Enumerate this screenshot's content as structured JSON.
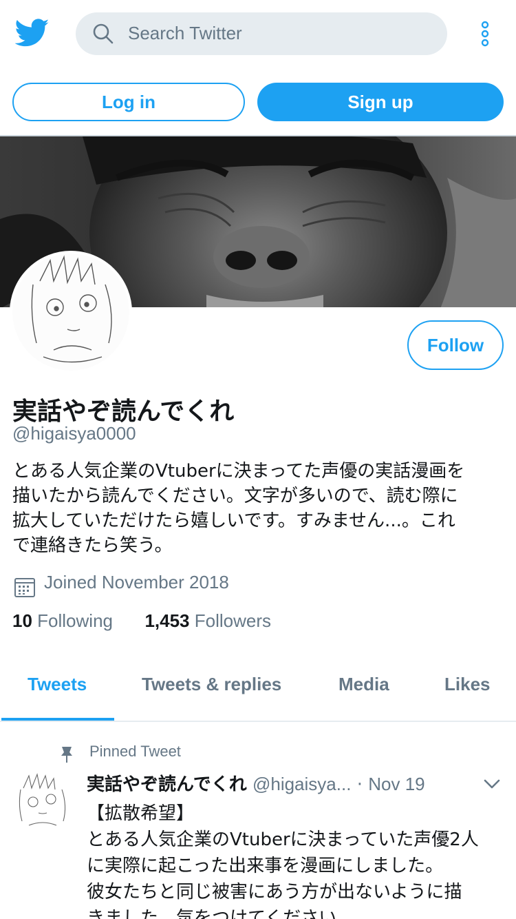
{
  "topbar": {
    "search_placeholder": "Search Twitter"
  },
  "auth": {
    "login_label": "Log in",
    "signup_label": "Sign up"
  },
  "profile": {
    "follow_label": "Follow",
    "display_name": "実話やぞ読んでくれ",
    "handle": "@higaisya0000",
    "bio_lines": [
      "とある人気企業のVtuberに決まってた声優の実話漫画を",
      "描いたから読んでください。文字が多いので、読む際に",
      "拡大していただけたら嬉しいです。すみません...。これ",
      "で連絡きたら笑う。"
    ],
    "joined": "Joined November 2018",
    "following_count": "10",
    "following_label": "Following",
    "followers_count": "1,453",
    "followers_label": "Followers"
  },
  "tabs": [
    {
      "label": "Tweets",
      "active": true
    },
    {
      "label": "Tweets & replies",
      "active": false
    },
    {
      "label": "Media",
      "active": false
    },
    {
      "label": "Likes",
      "active": false
    }
  ],
  "tweet": {
    "pinned_label": "Pinned Tweet",
    "name": "実話やぞ読んでくれ",
    "handle": "@higaisya...",
    "separator": "·",
    "date": "Nov 19",
    "body_lines": [
      "【拡散希望】",
      "とある人気企業のVtuberに決まっていた声優2人",
      "に実際に起こった出来事を漫画にしました。",
      "彼女たちと同じ被害にあう方が出ないように描",
      "きました。気をつけてください。"
    ]
  },
  "colors": {
    "brand": "#1da1f2",
    "muted": "#657786",
    "text": "#14171a",
    "search_bg": "#e6ecf0"
  }
}
